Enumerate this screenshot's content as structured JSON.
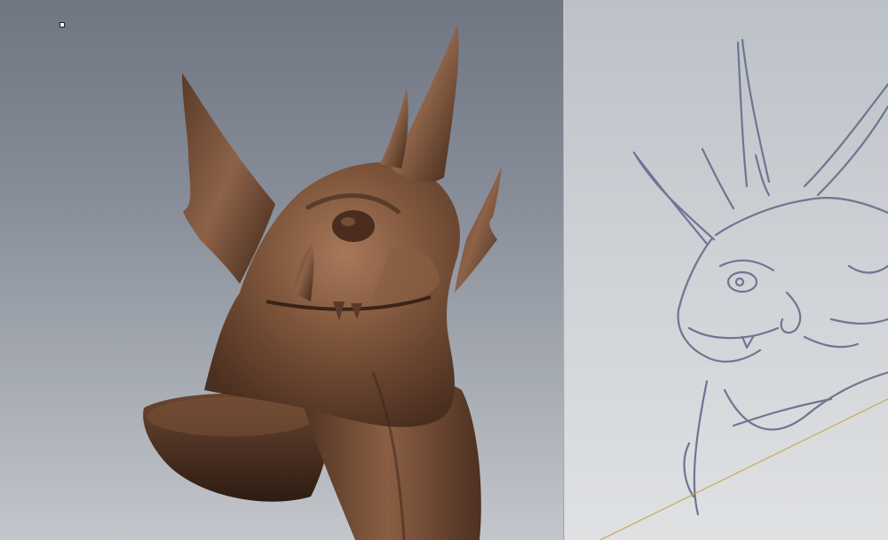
{
  "app": {
    "layout": "split-view",
    "panels": [
      {
        "name": "3d-viewport",
        "content": "sculpted-dragon-bust"
      },
      {
        "name": "reference-image",
        "content": "dragon-sketch"
      }
    ]
  },
  "colors": {
    "viewport_bg_top": "#6f7581",
    "viewport_bg_bottom": "#c3c6cb",
    "reference_bg": "#cfd2d6",
    "clay_base": "#6e4a33",
    "clay_highlight": "#a9785a",
    "clay_shadow": "#3a2418",
    "sketch_line": "#6f7592",
    "guide_line": "#c9a23a"
  },
  "icons": {
    "gizmo": "transform-handle-icon"
  }
}
